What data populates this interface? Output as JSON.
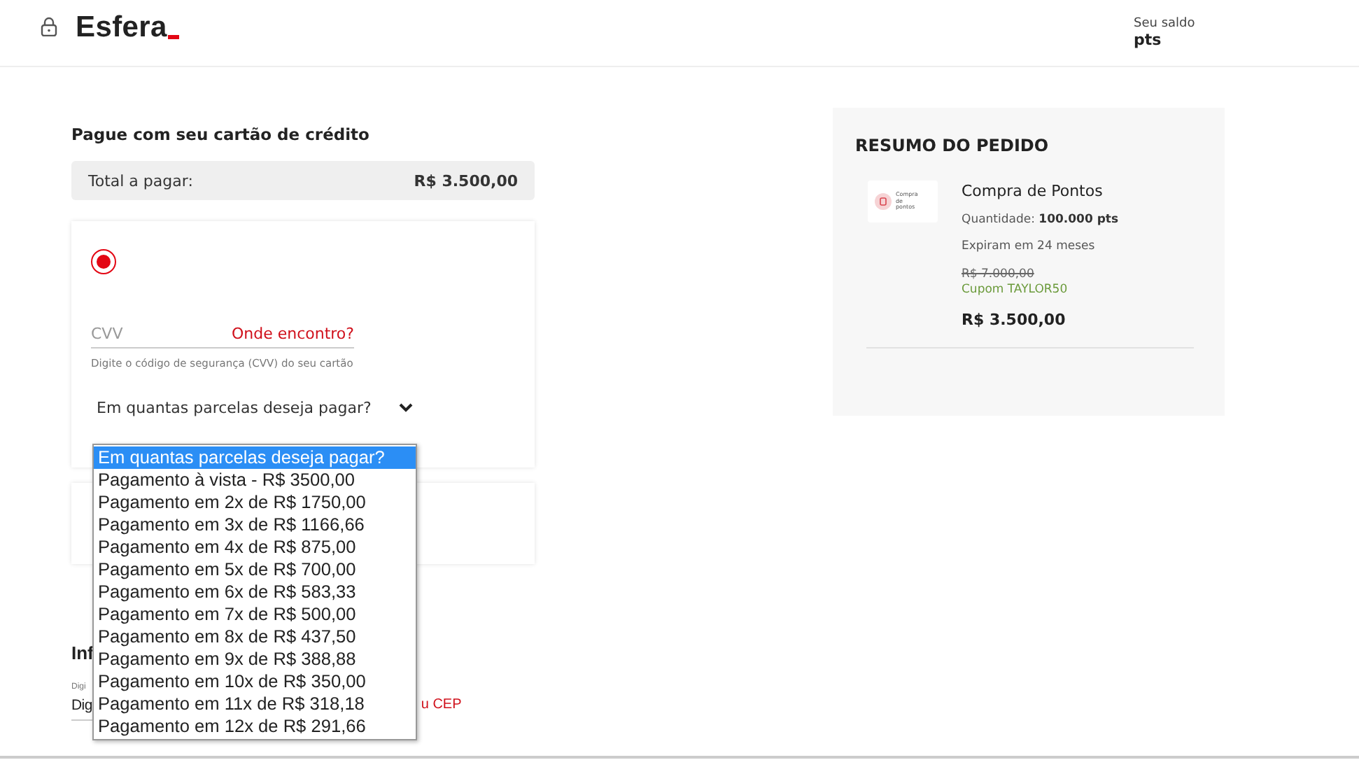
{
  "header": {
    "logo": "Esfera",
    "balance_label": "Seu saldo",
    "balance_value": "pts"
  },
  "payment": {
    "title": "Pague com seu cartão de crédito",
    "total_label": "Total a pagar:",
    "total_value": "R$ 3.500,00",
    "card": {
      "radio_selected": true,
      "cvv_placeholder": "CVV",
      "cvv_link": "Onde encontro?",
      "cvv_hint": "Digite o código de segurança (CVV) do seu cartão",
      "installments_value": "Em quantas parcelas deseja pagar?"
    }
  },
  "dropdown": {
    "options": [
      {
        "label": "Em quantas parcelas deseja pagar?",
        "selected": true
      },
      {
        "label": "Pagamento à vista - R$ 3500,00",
        "selected": false
      },
      {
        "label": "Pagamento em 2x de R$ 1750,00",
        "selected": false
      },
      {
        "label": "Pagamento em 3x de R$ 1166,66",
        "selected": false
      },
      {
        "label": "Pagamento em 4x de R$ 875,00",
        "selected": false
      },
      {
        "label": "Pagamento em 5x de R$ 700,00",
        "selected": false
      },
      {
        "label": "Pagamento em 6x de R$ 583,33",
        "selected": false
      },
      {
        "label": "Pagamento em 7x de R$ 500,00",
        "selected": false
      },
      {
        "label": "Pagamento em 8x de R$ 437,50",
        "selected": false
      },
      {
        "label": "Pagamento em 9x de R$ 388,88",
        "selected": false
      },
      {
        "label": "Pagamento em 10x de R$ 350,00",
        "selected": false
      },
      {
        "label": "Pagamento em 11x de R$ 318,18",
        "selected": false
      },
      {
        "label": "Pagamento em 12x de R$ 291,66",
        "selected": false
      }
    ]
  },
  "address": {
    "title": "Inf",
    "field_label": "Digi",
    "field_value": "Dig",
    "link": "u CEP"
  },
  "summary": {
    "title": "RESUMO DO PEDIDO",
    "thumbnail_text": "Compra de pontos",
    "product": "Compra de Pontos",
    "quantity_label": "Quantidade:",
    "quantity_value": "100.000 pts",
    "expiry": "Expiram em 24 meses",
    "old_price": "R$ 7.000,00",
    "coupon": "Cupom TAYLOR50",
    "price": "R$ 3.500,00"
  }
}
